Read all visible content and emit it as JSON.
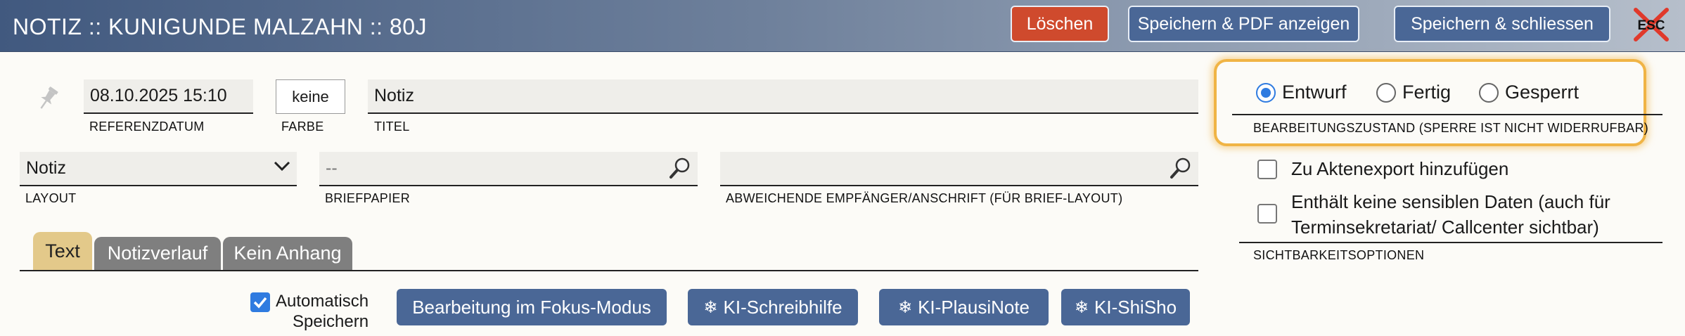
{
  "header": {
    "title": "NOTIZ :: KUNIGUNDE MALZAHN :: 80J",
    "delete_label": "Löschen",
    "save_pdf_label": "Speichern & PDF anzeigen",
    "save_close_label": "Speichern & schliessen",
    "esc_label": "ESC"
  },
  "fields": {
    "referenzdatum_value": "08.10.2025 15:10",
    "referenzdatum_label": "REFERENZDATUM",
    "farbe_value": "keine",
    "farbe_label": "FARBE",
    "titel_value": "Notiz",
    "titel_label": "TITEL",
    "layout_value": "Notiz",
    "layout_label": "LAYOUT",
    "briefpapier_value": "--",
    "briefpapier_label": "BRIEFPAPIER",
    "empfaenger_value": "",
    "empfaenger_label": "ABWEICHENDE EMPFÄNGER/ANSCHRIFT (FÜR BRIEF-LAYOUT)"
  },
  "status": {
    "options": [
      "Entwurf",
      "Fertig",
      "Gesperrt"
    ],
    "selected": "Entwurf",
    "label": "BEARBEITUNGSZUSTAND (SPERRE IST NICHT WIDERRUFBAR)"
  },
  "visibility": {
    "export_label": "Zu Aktenexport hinzufügen",
    "sensitive_line1": "Enthält keine sensiblen Daten (auch für",
    "sensitive_line2": "Terminsekretariat/ Callcenter sichtbar)",
    "label": "SICHTBARKEITSOPTIONEN"
  },
  "tabs": [
    {
      "label": "Text"
    },
    {
      "label": "Notizverlauf"
    },
    {
      "label": "Kein Anhang"
    }
  ],
  "toolbar": {
    "autosave_line1": "Automatisch",
    "autosave_line2": "Speichern",
    "focus_mode_label": "Bearbeitung im Fokus-Modus",
    "ki_schreibhilfe_label": "KI-Schreibhilfe",
    "ki_plausinote_label": "KI-PlausiNote",
    "ki_shisho_label": "KI-ShiSho",
    "ki_icon": "snowflake-icon"
  },
  "colors": {
    "header_start": "#41597f",
    "delete_button": "#cf4a2d",
    "primary_button": "#4a6796",
    "active_tab": "#e3c98a",
    "highlight_outline": "#f0b445",
    "radio_checked": "#2f7be0"
  }
}
